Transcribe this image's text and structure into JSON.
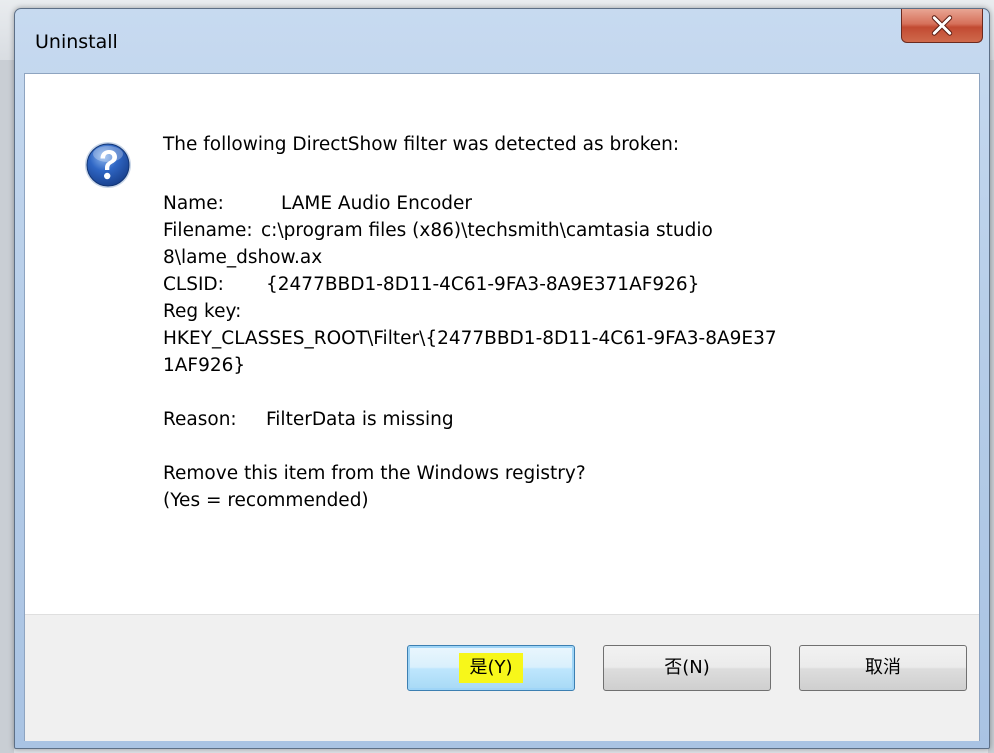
{
  "window": {
    "title": "Uninstall"
  },
  "message": {
    "intro": "The following DirectShow filter was detected as broken:",
    "name_label": "Name:",
    "name_value": "LAME Audio Encoder",
    "filename_label": "Filename:",
    "filename_value_line1": "c:\\program files (x86)\\techsmith\\camtasia studio",
    "filename_value_line2": "8\\lame_dshow.ax",
    "clsid_label": "CLSID:",
    "clsid_value": "{2477BBD1-8D11-4C61-9FA3-8A9E371AF926}",
    "regkey_label": "Reg key:",
    "regkey_value_line1": "HKEY_CLASSES_ROOT\\Filter\\{2477BBD1-8D11-4C61-9FA3-8A9E37",
    "regkey_value_line2": "1AF926}",
    "reason_label": "Reason:",
    "reason_value": "FilterData is missing",
    "question_line1": "Remove this item from the Windows registry?",
    "question_line2": "(Yes = recommended)"
  },
  "buttons": {
    "yes": "是(Y)",
    "no": "否(N)",
    "cancel": "取消"
  },
  "icons": {
    "close": "close-icon",
    "question": "question-icon"
  },
  "colors": {
    "close_button": "#c24a32",
    "question_icon": "#1f4fa8",
    "highlight": "#f7f71a",
    "default_button_border": "#3c7fb1"
  }
}
